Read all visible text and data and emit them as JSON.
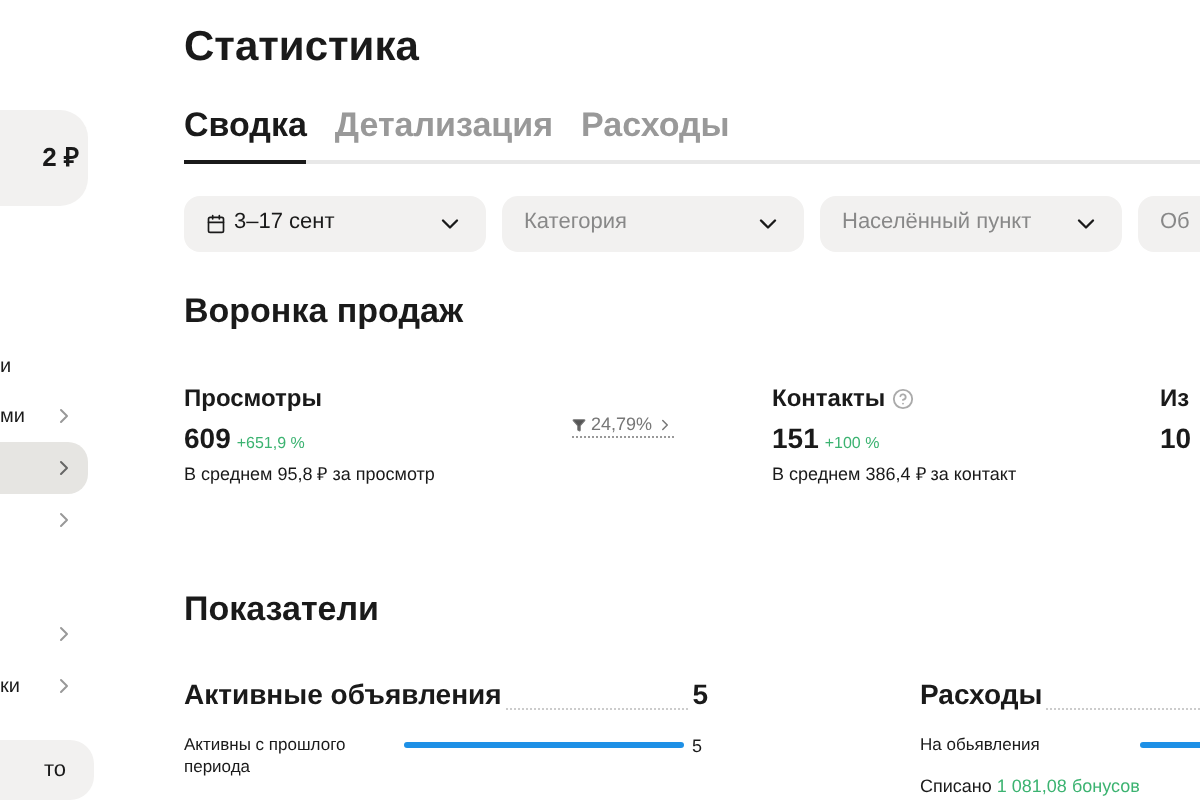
{
  "sidebar": {
    "balance": "2 ₽",
    "groups": [
      [
        {
          "label": "ми",
          "selected": false
        },
        {
          "selected": true
        },
        {
          "selected": false
        }
      ],
      [
        {
          "selected": false
        },
        {
          "label": "ки",
          "selected": false
        }
      ]
    ],
    "heading": "и",
    "bottom_card": "то"
  },
  "title": "Статистика",
  "tabs": [
    {
      "label": "Сводка",
      "selected": true
    },
    {
      "label": "Детализация",
      "selected": false
    },
    {
      "label": "Расходы",
      "selected": false
    }
  ],
  "filters": [
    {
      "kind": "date",
      "value": "3–17 сент"
    },
    {
      "kind": "select",
      "placeholder": "Категория"
    },
    {
      "kind": "select",
      "placeholder": "Населённый пункт"
    },
    {
      "kind": "select_cut",
      "placeholder": "Об"
    }
  ],
  "funnel": {
    "title": "Воронка продаж",
    "metrics": [
      {
        "label": "Просмотры",
        "value": "609",
        "change": "+651,9 %",
        "note": "В среднем 95,8 ₽ за просмотр",
        "help": false,
        "conversion": "24,79%"
      },
      {
        "label": "Контакты",
        "value": "151",
        "change": "+100 %",
        "note": "В среднем 386,4 ₽ за контакт",
        "help": true
      },
      {
        "label": "Из",
        "value": "10",
        "help": false
      }
    ]
  },
  "indicators": {
    "title": "Показатели",
    "cards": [
      {
        "title": "Активные объявления",
        "total": "5",
        "rows": [
          {
            "kind": "bar",
            "label": "Активны с прошлого периода",
            "value": "5"
          }
        ]
      },
      {
        "title": "Расходы",
        "rows": [
          {
            "kind": "bar",
            "label": "На обьявления"
          },
          {
            "kind": "note",
            "prefix": "Списано",
            "highlight": "1 081,08 бонусов"
          }
        ]
      }
    ]
  }
}
